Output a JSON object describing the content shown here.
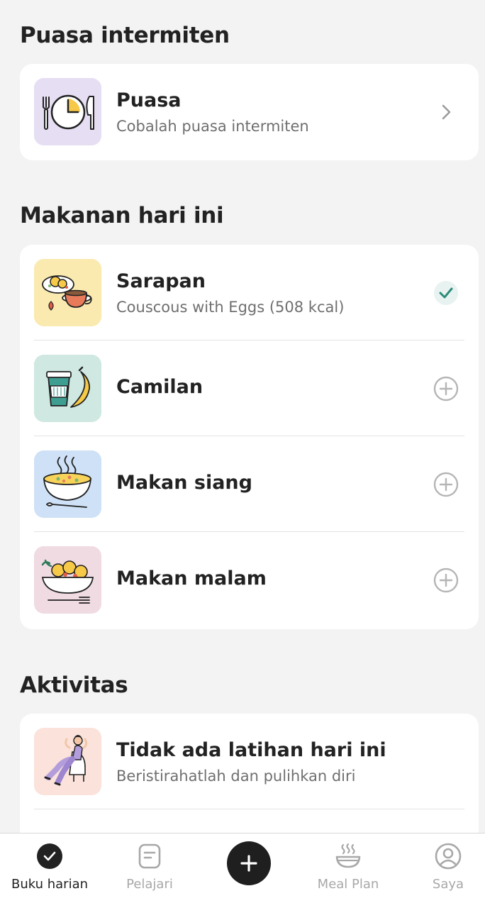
{
  "fasting": {
    "section_title": "Puasa intermiten",
    "card": {
      "title": "Puasa",
      "subtitle": "Cobalah puasa intermiten",
      "icon": "clock-cutlery-icon",
      "trailing_icon": "chevron-right-icon"
    }
  },
  "meals": {
    "section_title": "Makanan hari ini",
    "items": [
      {
        "title": "Sarapan",
        "subtitle": "Couscous with Eggs (508 kcal)",
        "icon": "breakfast-icon",
        "status": "checked",
        "bg": "#faeab0"
      },
      {
        "title": "Camilan",
        "icon": "snack-icon",
        "status": "add",
        "bg": "#cfe8e2"
      },
      {
        "title": "Makan siang",
        "icon": "lunch-icon",
        "status": "add",
        "bg": "#cfe1f6"
      },
      {
        "title": "Makan malam",
        "icon": "dinner-icon",
        "status": "add",
        "bg": "#f0dbe2"
      }
    ]
  },
  "activity": {
    "section_title": "Aktivitas",
    "items": [
      {
        "title": "Tidak ada latihan hari ini",
        "subtitle": "Beristirahatlah dan pulihkan diri",
        "icon": "resting-person-icon",
        "bg": "#fbe3dc"
      }
    ]
  },
  "nav": {
    "items": [
      {
        "label": "Buku harian",
        "icon": "diary-check-icon",
        "active": true
      },
      {
        "label": "Pelajari",
        "icon": "learn-note-icon",
        "active": false
      },
      {
        "label": "",
        "icon": "plus-icon",
        "active": false
      },
      {
        "label": "Meal Plan",
        "icon": "steaming-bowl-icon",
        "active": false
      },
      {
        "label": "Saya",
        "icon": "profile-icon",
        "active": false
      }
    ]
  },
  "colors": {
    "background": "#f3f3f3",
    "card": "#ffffff",
    "accent_check": "#2e8b7a",
    "text_primary": "#222222",
    "text_secondary": "#6f6f6f",
    "nav_inactive": "#a8a8a8"
  }
}
